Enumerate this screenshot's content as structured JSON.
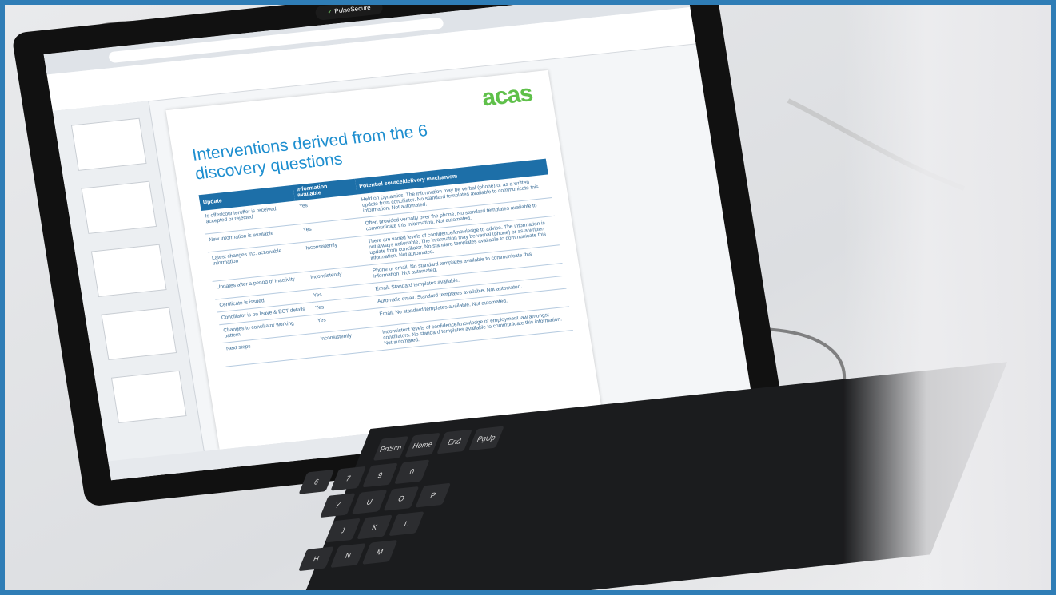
{
  "webcam_cover": {
    "brand": "PulseSecure"
  },
  "slide": {
    "logo": "acas",
    "title": "Interventions derived from the 6 discovery questions",
    "table": {
      "headers": [
        "Update",
        "Information available",
        "Potential source/delivery mechanism"
      ],
      "rows": [
        [
          "Is offer/counteroffer is received, accepted or rejected",
          "Yes",
          "Held on Dynamics. The information may be verbal (phone) or as a written update from conciliator. No standard templates available to communicate this information. Not automated."
        ],
        [
          "New information is available",
          "Yes",
          "Often provided verbally over the phone. No standard templates available to communicate this information. Not automated."
        ],
        [
          "Latest changes inc. actionable information",
          "Inconsistently",
          "There are varied levels of confidence/knowledge to advise. The information is not always actionable. The information may be verbal (phone) or as a written update from conciliator. No standard templates available to communicate this information. Not automated."
        ],
        [
          "Updates after a period of inactivity",
          "Inconsistently",
          "Phone or email. No standard templates available to communicate this information. Not automated."
        ],
        [
          "Certificate is issued",
          "Yes",
          "Email. Standard templates available."
        ],
        [
          "Conciliator is on leave & ECT details",
          "Yes",
          "Automatic email. Standard templates available. Not automated."
        ],
        [
          "Changes to conciliator working pattern",
          "Yes",
          "Email. No standard templates available. Not automated."
        ],
        [
          "Next steps",
          "Inconsistently",
          "Inconsistent levels of confidence/knowledge of employment law amongst conciliators. No standard templates available to communicate this information. Not automated."
        ]
      ]
    }
  },
  "keyboard": {
    "keys": [
      "PrtScn",
      "Home",
      "End",
      "PgUp",
      "9",
      "0",
      "P",
      "O",
      "L",
      "K",
      "M",
      "N",
      "U",
      "J",
      "H",
      "7",
      "6",
      "Y"
    ]
  },
  "colors": {
    "frame": "#2f7db6",
    "slide_title": "#1d8ecf",
    "table_header": "#1d6fa8",
    "logo": "#5fc04a"
  }
}
